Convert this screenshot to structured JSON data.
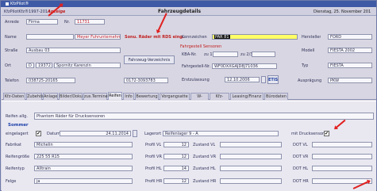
{
  "window": {
    "title": "KfzPilot®"
  },
  "header": {
    "record": "KfzPilotKfz®1997-2014",
    "record_link": "Anzeige",
    "section_title": "Fahrzeugdetails",
    "date": "Dienstag, 25. November 201"
  },
  "annotations": {
    "rdks": "Sonu. Räder mit RDS eing.",
    "sensors": "Fahrgestell Sensoren"
  },
  "customer": {
    "anrede_label": "Anrede",
    "anrede": "Firma",
    "nr_label": "Nr.",
    "nr": "11731",
    "name_label": "Name",
    "name": "",
    "name_note": "Meyer Fuhrunternehm",
    "strasse_label": "Straße",
    "strasse": "Ausbau 03",
    "ort_label": "Ort",
    "land": "D",
    "plz": "19372",
    "ort": "Spornitz Karenzin",
    "telefon_label": "Telefon",
    "telefon": "038725-20165",
    "telefon2": "0172-3093783",
    "vehicle_list_button": "Fahrzeug-Verzeichnis"
  },
  "vehicle": {
    "kennzeichen_label": "Kennzeichen",
    "kennzeichen": "PAR 81",
    "kba_label": "KBA-Nr.",
    "zu1_label": "zu 1",
    "zu23_label": "zu 2/3",
    "fgn_label": "Fahrgestell-Nr.",
    "fgn": "WF0DXXGAJD8J71036",
    "ez_label": "Erstzulassung",
    "ez": "12.10.2006",
    "etis_button": "ETIS",
    "hersteller_label": "Hersteller",
    "hersteller": "FORD",
    "modell_label": "Modell",
    "modell": "FIESTA 2002",
    "typ_label": "Typ",
    "typ": "FIESTA",
    "auspraegung_label": "Ausprägung",
    "auspraegung": "PKW"
  },
  "tabs": [
    "Kfz-Daten",
    "Zubehör",
    "Anlage",
    "Bilder/Doku",
    "zus.Termine",
    "Reifen",
    "Info",
    "Bewertung",
    "Vorgangsatte",
    "W-Hilfen",
    "Kfz-Codes",
    "Leasing/Finanz",
    "Bürodaten"
  ],
  "tires": {
    "reifen_allg_label": "Reifen allg.",
    "reifen_allg": "Phantom Räder für Drucksensoren",
    "season": "Sommer",
    "eingelagert_label": "eingelagert",
    "datum_label": "Datum",
    "datum": "24.11.2014",
    "lagerort_label": "Lagerort",
    "lagerort": "Reifenlager 9 - A",
    "drucksensor_label": "mit Drucksensor",
    "fabrikat_label": "Fabrikat",
    "fabrikat": "Michelin",
    "groesse_label": "Reifengröße",
    "groesse": "225 55 R15",
    "typ_label": "Reifentyp",
    "typ": "Alltrain",
    "felge_label": "Felge",
    "felge": "ja",
    "profil_labels": [
      "Profil VL",
      "Profil VR",
      "Profil HL",
      "Profil HR"
    ],
    "profil_values": [
      "12",
      "12",
      "14",
      "12"
    ],
    "zustand_labels": [
      "Zustand VL",
      "Zustand VR",
      "Zustand HL",
      "Zustand HR"
    ],
    "dot_labels": [
      "DOT VL",
      "DOT VR",
      "DOT HL",
      "DOT HR"
    ]
  }
}
